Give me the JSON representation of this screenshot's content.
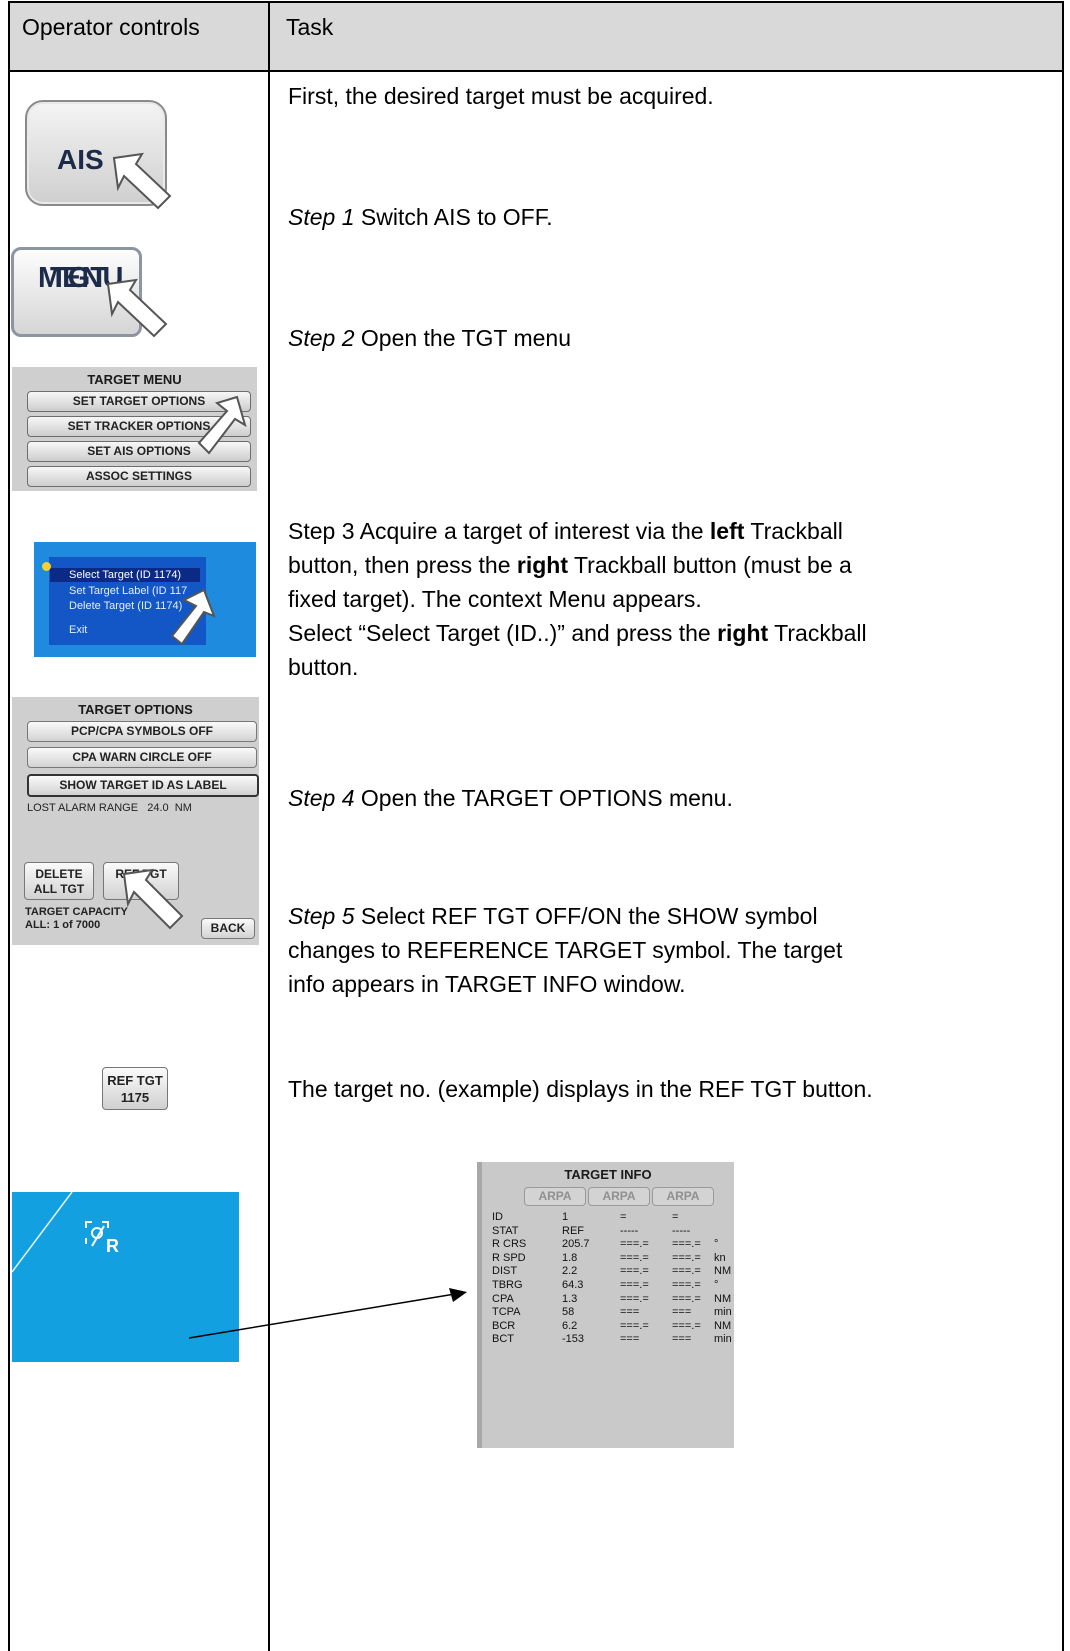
{
  "header": {
    "col1": "Operator controls",
    "col2": "Task"
  },
  "tasks": {
    "intro": "First, the desired target must be acquired.",
    "step1_label": "Step 1",
    "step1_text": " Switch AIS to OFF.",
    "step2_label": "Step 2",
    "step2_text": " Open the TGT menu",
    "step3_line1_a": "Step 3 Acquire a target of interest via the ",
    "step3_line1_b": "left",
    "step3_line1_c": " Trackball",
    "step3_line2_a": "button, then press the ",
    "step3_line2_b": "right",
    "step3_line2_c": " Trackball button (must be a",
    "step3_line3": "fixed target). The context Menu appears.",
    "step3_line4_a": "Select “Select Target (ID..)” and press the ",
    "step3_line4_b": "right",
    "step3_line4_c": " Trackball",
    "step3_line5": "button.",
    "step4_label": "Step 4",
    "step4_text": " Open the TARGET OPTIONS menu.",
    "step5_label": "Step 5",
    "step5_line1": " Select REF TGT OFF/ON the SHOW symbol",
    "step5_line2": "changes to REFERENCE TARGET symbol. The target",
    "step5_line3": "info appears in TARGET INFO window.",
    "ref_note": "The target no. (example) displays in the REF TGT button."
  },
  "controls": {
    "ais_button": "AIS",
    "tgt_menu_line1": "TGT",
    "tgt_menu_line2": "MENU",
    "target_menu": {
      "title": "TARGET MENU",
      "items": [
        "SET TARGET OPTIONS",
        "SET TRACKER OPTIONS",
        "SET AIS OPTIONS",
        "ASSOC SETTINGS"
      ]
    },
    "context_menu": {
      "items": [
        "Select Target (ID 1174)",
        "Set Target Label (ID 117",
        "Delete Target (ID 1174)",
        "Exit"
      ]
    },
    "target_options": {
      "title": "TARGET OPTIONS",
      "buttons": [
        "PCP/CPA SYMBOLS OFF",
        "CPA WARN CIRCLE OFF",
        "SHOW TARGET ID AS LABEL"
      ],
      "lost_alarm": "LOST ALARM RANGE",
      "lost_alarm_value": "24.0",
      "lost_alarm_unit": "NM",
      "delete_line1": "DELETE",
      "delete_line2": "ALL TGT",
      "reftgt_line1": "REF TGT",
      "reftgt_line2": "OFF",
      "capacity_line1": "TARGET CAPACITY",
      "capacity_line2": "ALL: 1 of 7000",
      "back": "BACK"
    },
    "ref_tgt_button_line1": "REF TGT",
    "ref_tgt_button_line2": "1175",
    "symbol_label": "R"
  },
  "target_info": {
    "title": "TARGET INFO",
    "tabs": [
      "ARPA",
      "ARPA",
      "ARPA"
    ],
    "rows": [
      {
        "label": "ID",
        "v1": "1",
        "v2": "=",
        "v3": "=",
        "unit": ""
      },
      {
        "label": "STAT",
        "v1": "REF",
        "v2": "-----",
        "v3": "-----",
        "unit": ""
      },
      {
        "label": "R CRS",
        "v1": "205.7",
        "v2": "===.=",
        "v3": "===.=",
        "unit": "°"
      },
      {
        "label": "R SPD",
        "v1": "1.8",
        "v2": "===.=",
        "v3": "===.=",
        "unit": "kn"
      },
      {
        "label": "DIST",
        "v1": "2.2",
        "v2": "===.=",
        "v3": "===.=",
        "unit": "NM"
      },
      {
        "label": "TBRG",
        "v1": "64.3",
        "v2": "===.=",
        "v3": "===.=",
        "unit": "°"
      },
      {
        "label": "CPA",
        "v1": "1.3",
        "v2": "===.=",
        "v3": "===.=",
        "unit": "NM"
      },
      {
        "label": "TCPA",
        "v1": "58",
        "v2": "===",
        "v3": "===",
        "unit": "min"
      },
      {
        "label": "BCR",
        "v1": "6.2",
        "v2": "===.=",
        "v3": "===.=",
        "unit": "NM"
      },
      {
        "label": "BCT",
        "v1": "-153",
        "v2": "===",
        "v3": "===",
        "unit": "min"
      }
    ]
  }
}
